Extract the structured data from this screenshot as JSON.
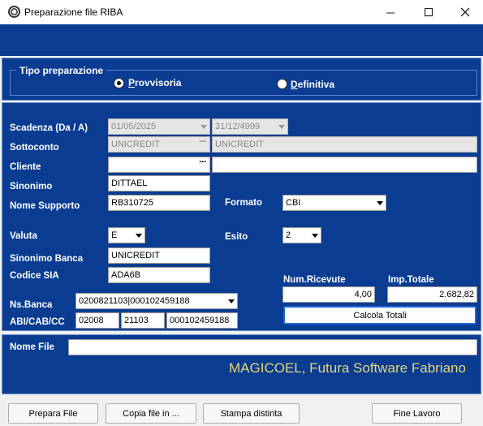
{
  "window": {
    "title": "Preparazione file RIBA",
    "icon": "settings-gear-icon"
  },
  "tipo_preparazione": {
    "label": "Tipo preparazione",
    "options": [
      {
        "label": "Provvisoria",
        "selected": true
      },
      {
        "label": "Definitiva",
        "selected": false
      }
    ]
  },
  "form": {
    "scadenza": {
      "label": "Scadenza (Da / A)",
      "from": "01/05/2025",
      "to": "31/12/4999"
    },
    "sottoconto": {
      "label": "Sottoconto",
      "code": "UNICREDIT",
      "description": "UNICREDIT"
    },
    "cliente": {
      "label": "Cliente",
      "code": "",
      "description": ""
    },
    "sinonimo": {
      "label": "Sinonimo",
      "value": "DITTAEL"
    },
    "nome_supporto": {
      "label": "Nome Supporto",
      "value": "RB310725"
    },
    "formato": {
      "label": "Formato",
      "value": "CBI"
    },
    "valuta": {
      "label": "Valuta",
      "value": "E"
    },
    "esito": {
      "label": "Esito",
      "value": "2"
    },
    "sinonimo_banca": {
      "label": "Sinonimo Banca",
      "value": "UNICREDIT"
    },
    "codice_sia": {
      "label": "Codice SIA",
      "value": "ADA6B"
    },
    "ns_banca": {
      "label": "Ns.Banca",
      "value": "0200821103|000102459188"
    },
    "abi_cab_cc": {
      "label": "ABI/CAB/CC",
      "abi": "02008",
      "cab": "21103",
      "cc": "000102459188"
    },
    "num_ricevute": {
      "label": "Num.Ricevute",
      "value": "4,00"
    },
    "imp_totale": {
      "label": "Imp.Totale",
      "value": "2.682,82"
    },
    "calcola_totali": "Calcola Totali"
  },
  "nome_file": {
    "label": "Nome File",
    "value": ""
  },
  "brand": "MAGICOEL, Futura Software Fabriano",
  "buttons": {
    "prepara_file": "Prepara File",
    "copia_file": "Copia file in ...",
    "stampa_distinta": "Stampa distinta",
    "fine_lavoro": "Fine Lavoro"
  },
  "colors": {
    "panel_blue": "#0a3d91",
    "brand_text": "#e6d47a",
    "calc_button_border": "#1d63d8"
  }
}
